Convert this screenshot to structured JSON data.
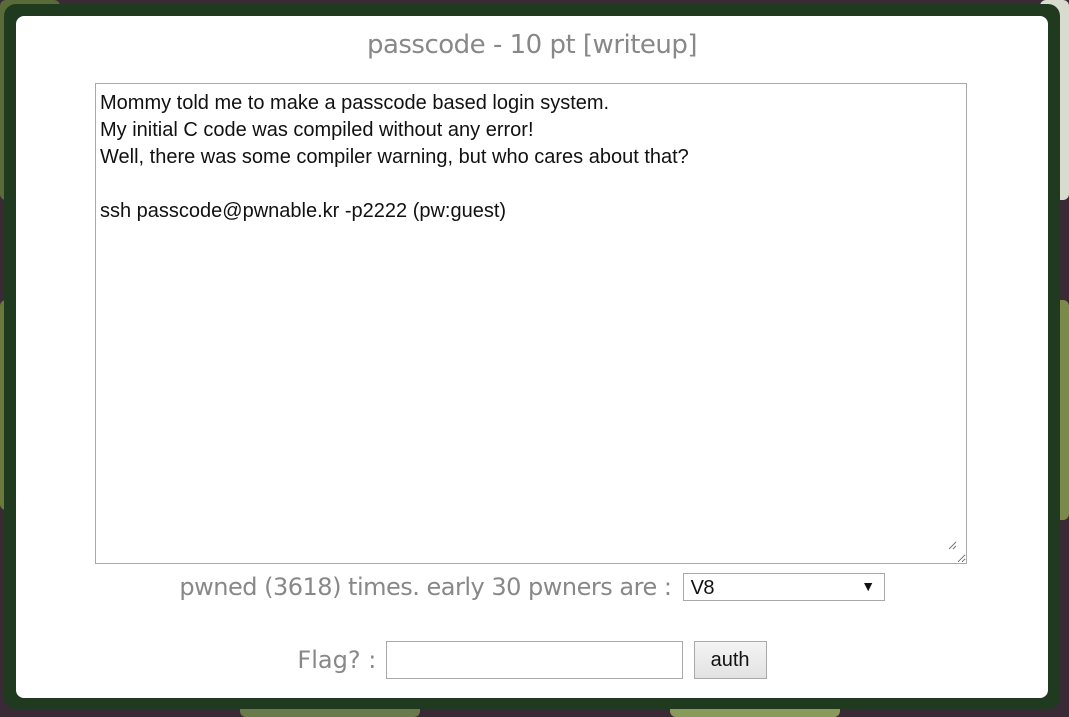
{
  "challenge": {
    "name": "passcode",
    "separator": "-",
    "points": "10 pt",
    "writeup_link": "[writeup]"
  },
  "description": {
    "text": "Mommy told me to make a passcode based login system.\nMy initial C code was compiled without any error!\nWell, there was some compiler warning, but who cares about that?\n\nssh passcode@pwnable.kr -p2222 (pw:guest)"
  },
  "stats": {
    "prefix": "pwned (3618) times. early 30 pwners are :",
    "pwners_select_value": "V8"
  },
  "flag_form": {
    "label": "Flag? :",
    "input_value": "",
    "submit_label": "auth"
  },
  "colors": {
    "frame": "#1f3a1f",
    "muted_text": "#888888",
    "background": "#3a2a36"
  }
}
